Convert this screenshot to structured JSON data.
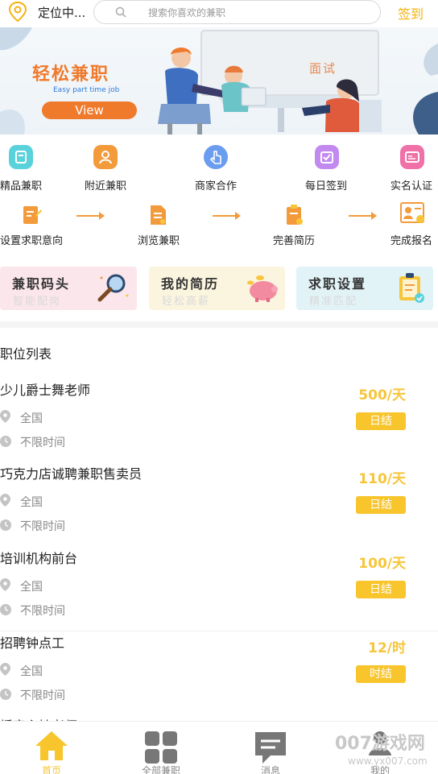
{
  "header": {
    "location_text": "定位中...",
    "search_placeholder": "搜索你喜欢的兼职",
    "signin_label": "签到"
  },
  "banner": {
    "title": "轻松兼职",
    "subtitle": "Easy part time job",
    "button_label": "View",
    "sign_text": "面试"
  },
  "categories": [
    {
      "label": "精品兼职",
      "icon": "star-box-icon",
      "color": "#5ad2dc"
    },
    {
      "label": "附近兼职",
      "icon": "location-person-icon",
      "color": "#f39b3b"
    },
    {
      "label": "商家合作",
      "icon": "hand-tap-icon",
      "color": "#6a9cf0"
    },
    {
      "label": "每日签到",
      "icon": "calendar-check-icon",
      "color": "#c28af0"
    },
    {
      "label": "实名认证",
      "icon": "id-card-icon",
      "color": "#f070a8"
    }
  ],
  "steps": [
    {
      "label": "设置求职意向",
      "icon": "edit-doc-icon"
    },
    {
      "label": "浏览兼职",
      "icon": "doc-view-icon"
    },
    {
      "label": "完善简历",
      "icon": "clipboard-check-icon"
    },
    {
      "label": "完成报名",
      "icon": "profile-check-icon"
    }
  ],
  "cards": [
    {
      "title": "兼职码头",
      "subtitle": "智能配岗",
      "bg": "#fbe6ec",
      "art": "magnifier-icon"
    },
    {
      "title": "我的简历",
      "subtitle": "轻松高薪",
      "bg": "#fbf4de",
      "art": "piggy-bank-icon"
    },
    {
      "title": "求职设置",
      "subtitle": "精准匹配",
      "bg": "#e2f3f8",
      "art": "clipboard-icon"
    }
  ],
  "section_title": "职位列表",
  "jobs": [
    {
      "title": "少儿爵士舞老师",
      "salary": "500/天",
      "location": "全国",
      "time": "不限时间",
      "settle": "日结"
    },
    {
      "title": "巧克力店诚聘兼职售卖员",
      "salary": "110/天",
      "location": "全国",
      "time": "不限时间",
      "settle": "日结"
    },
    {
      "title": "培训机构前台",
      "salary": "100/天",
      "location": "全国",
      "time": "不限时间",
      "settle": "日结"
    },
    {
      "title": "招聘钟点工",
      "salary": "12/时",
      "location": "全国",
      "time": "不限时间",
      "settle": "时结"
    },
    {
      "title": "播音主持老师",
      "salary": "",
      "location": "",
      "time": "",
      "settle": ""
    }
  ],
  "nav": [
    {
      "label": "首页",
      "icon": "home-icon",
      "active": true
    },
    {
      "label": "全部兼职",
      "icon": "grid-icon",
      "active": false
    },
    {
      "label": "消息",
      "icon": "message-icon",
      "active": false
    },
    {
      "label": "我的",
      "icon": "user-icon",
      "active": false
    }
  ],
  "watermark": {
    "main": "007游戏网",
    "sub": "www.yx007.com"
  },
  "colors": {
    "accent": "#f8c52c",
    "salary": "#f7c53a",
    "orange": "#f39b3b"
  }
}
